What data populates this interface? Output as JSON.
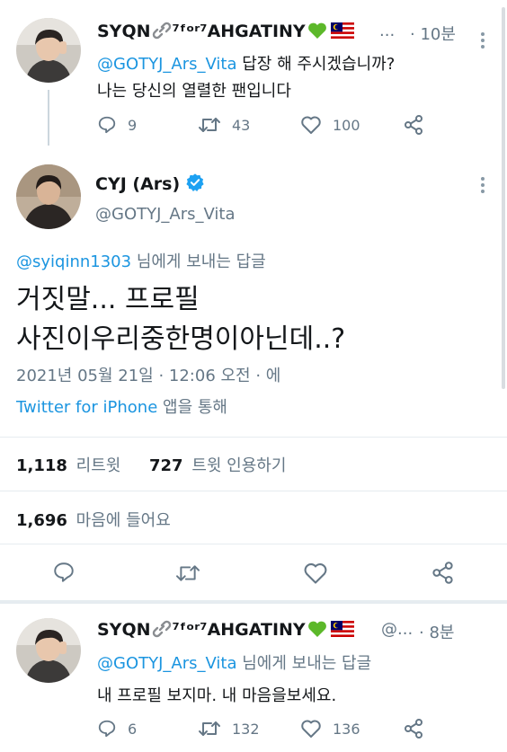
{
  "reply1": {
    "name": "SYQN",
    "name_mid": "⁷ᶠᵒʳ⁷AHGATINY",
    "handle_truncated": "...",
    "time": "· 10분",
    "mention": "@GOTYJ_Ars_Vita",
    "text_line1_suffix": " 답장 해 주시겠습니까?",
    "text_line2": "나는 당신의 열렬한 팬입니다",
    "replies": "9",
    "retweets": "43",
    "likes": "100"
  },
  "main_tweet": {
    "name": "CYJ (Ars)",
    "handle": "@GOTYJ_Ars_Vita",
    "reply_to_handle": "@syiqinn1303",
    "reply_to_suffix": " 님에게 보내는 답글",
    "text_line1": "거짓말... 프로필",
    "text_line2": "사진이우리중한명이아닌데..?",
    "timestamp": "2021년 05월 21일 · 12:06 오전 · 에",
    "source": "Twitter for iPhone",
    "source_suffix": " 앱을 통해",
    "retweet_count": "1,118",
    "retweet_label": "리트윗",
    "quote_count": "727",
    "quote_label": "트윗 인용하기",
    "like_count": "1,696",
    "like_label": "마음에 들어요"
  },
  "reply2": {
    "name": "SYQN",
    "name_mid": "⁷ᶠᵒʳ⁷AHGATINY",
    "handle_truncated": "@...",
    "time": "· 8분",
    "mention": "@GOTYJ_Ars_Vita",
    "reply_suffix": " 님에게 보내는 답글",
    "text": "내 프로필 보지마. 내 마음을보세요.",
    "replies": "6",
    "retweets": "132",
    "likes": "136"
  },
  "colors": {
    "accent": "#1b95e0",
    "muted": "#657786",
    "text": "#14171a",
    "heart": "#5cb82a",
    "verified": "#1da1f2"
  }
}
